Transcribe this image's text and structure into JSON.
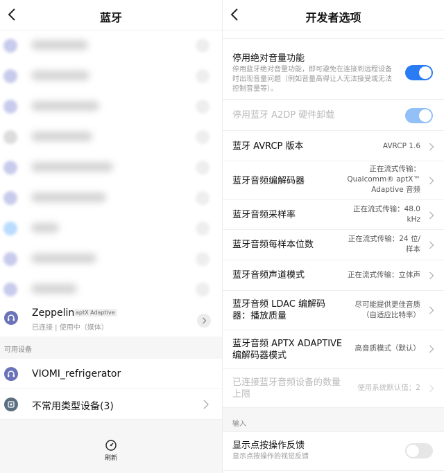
{
  "left": {
    "header": {
      "title": "蓝牙",
      "back_icon": "back-icon"
    },
    "paired_blurred_count": 9,
    "zeppelin": {
      "name": "Zeppelin",
      "codec_tag": "aptX Adaptive",
      "status": "已连接 | 使用中（媒体）",
      "icon": "headset-icon"
    },
    "available_label": "可用设备",
    "available": [
      {
        "name": "VIOMI_refrigerator",
        "icon": "headset-icon"
      },
      {
        "name": "不常用类型设备(3)",
        "icon": "misc-device-icon"
      }
    ],
    "refresh_label": "刷新"
  },
  "right": {
    "header": {
      "title": "开发者选项",
      "back_icon": "back-icon"
    },
    "rows": {
      "abs_volume": {
        "title": "停用绝对音量功能",
        "desc": "停用蓝牙绝对音量功能，即可避免在连接到远程设备时出现音量问题（例如音量高得让人无法接受或无法控制音量等）。",
        "toggle": "on"
      },
      "a2dp_offload": {
        "title": "停用蓝牙 A2DP 硬件卸载",
        "toggle": "on-disabled"
      },
      "avrcp": {
        "title": "蓝牙 AVRCP 版本",
        "value": "AVRCP 1.6"
      },
      "codec": {
        "title": "蓝牙音频编解码器",
        "value_line1": "正在流式传输：",
        "value_line2": "Qualcomm® aptX™",
        "value_line3": "Adaptive 音频"
      },
      "sample_rate": {
        "title": "蓝牙音频采样率",
        "value_line1": "正在流式传输：48.0",
        "value_line2": "kHz"
      },
      "bits": {
        "title": "蓝牙音频每样本位数",
        "value_line1": "正在流式传输：24 位/",
        "value_line2": "样本"
      },
      "channel": {
        "title": "蓝牙音频声道模式",
        "value": "正在流式传输：立体声"
      },
      "ldac": {
        "title_line1": "蓝牙音频 LDAC 编解码",
        "title_line2": "器：播放质量",
        "value_line1": "尽可能提供更佳音质",
        "value_line2": "（自适应比特率）"
      },
      "aptx": {
        "title_line1": "蓝牙音频 APTX ADAPTIVE",
        "title_line2": "编解码器模式",
        "value": "高音质模式（默认）"
      },
      "max_devices": {
        "title_line1": "已连接蓝牙音频设备的数量",
        "title_line2": "上限",
        "value": "使用系统默认值：2"
      }
    },
    "input_label": "输入",
    "show_taps": {
      "title": "显示点按操作反馈",
      "desc": "显示点按操作的视觉反馈",
      "toggle": "off"
    }
  },
  "colors": {
    "accent": "#2a7cf5",
    "accent_disabled": "#92c0f7",
    "device_icon": "#6a72b8"
  }
}
